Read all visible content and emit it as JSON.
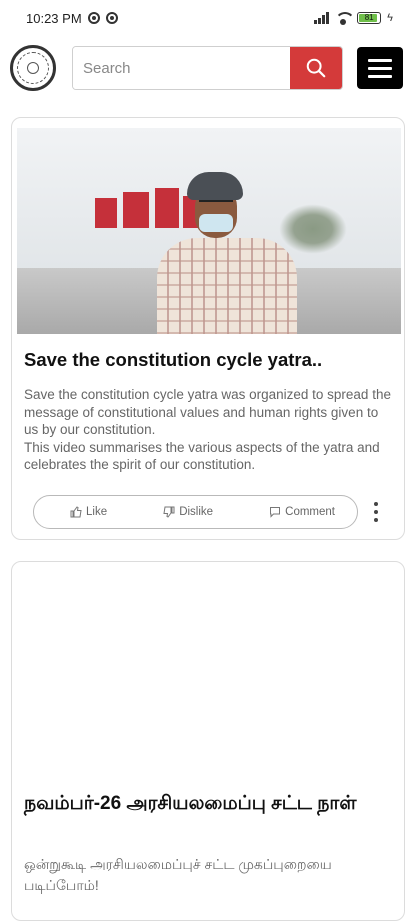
{
  "status_bar": {
    "time": "10:23 PM",
    "battery": "81"
  },
  "header": {
    "search_placeholder": "Search"
  },
  "colors": {
    "search_button": "#d43a3a",
    "menu_button": "#000000"
  },
  "icons": {
    "logo": "emblem-logo",
    "search": "search-icon",
    "menu": "hamburger-menu-icon"
  },
  "posts": [
    {
      "title": "Save the constitution cycle yatra..",
      "description": "Save the constitution cycle yatra was organized to spread the message of constitutional values and human rights given to us by our constitution.\nThis video summarises the various aspects of the yatra and celebrates the spirit of our constitution.",
      "actions": {
        "like": "Like",
        "dislike": "Dislike",
        "comment": "Comment"
      }
    },
    {
      "title": "நவம்பர்-26 அரசியலமைப்பு சட்ட நாள்",
      "description": "ஒன்றுகூடி அரசியலமைப்புச் சட்ட முகப்புறையை படிப்போம்!"
    }
  ]
}
